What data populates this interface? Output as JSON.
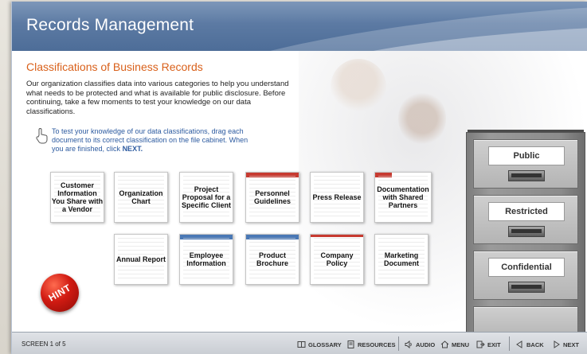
{
  "app": {
    "title": "Records Management"
  },
  "heading": "Classifications of Business Records",
  "intro": "Our organization classifies data into various categories to help you understand what needs to be protected and what is available for public disclosure. Before continuing, take a few moments to test your knowledge on our data classifications.",
  "instruction": {
    "text": "To test your knowledge of our data classifications, drag each document to its correct classification on the file cabinet. When you are finished, click",
    "next": "NEXT."
  },
  "documents": [
    {
      "label": "Customer Information You Share with a Vendor"
    },
    {
      "label": "Organization Chart"
    },
    {
      "label": "Project Proposal for a Specific Client"
    },
    {
      "label": "Personnel Guidelines"
    },
    {
      "label": "Press Release"
    },
    {
      "label": "Documentation with Shared Partners"
    },
    {
      "label": "Annual Report"
    },
    {
      "label": "Employee Information"
    },
    {
      "label": "Product Brochure"
    },
    {
      "label": "Company Policy"
    },
    {
      "label": "Marketing Document"
    }
  ],
  "hint": {
    "label": "HINT"
  },
  "cabinet": {
    "drawers": [
      "Public",
      "Restricted",
      "Confidential"
    ]
  },
  "footer": {
    "screen": "SCREEN 1 of 5",
    "glossary": "GLOSSARY",
    "resources": "RESOURCES",
    "audio": "AUDIO",
    "menu": "MENU",
    "exit": "EXIT",
    "back": "BACK",
    "next": "NEXT"
  }
}
